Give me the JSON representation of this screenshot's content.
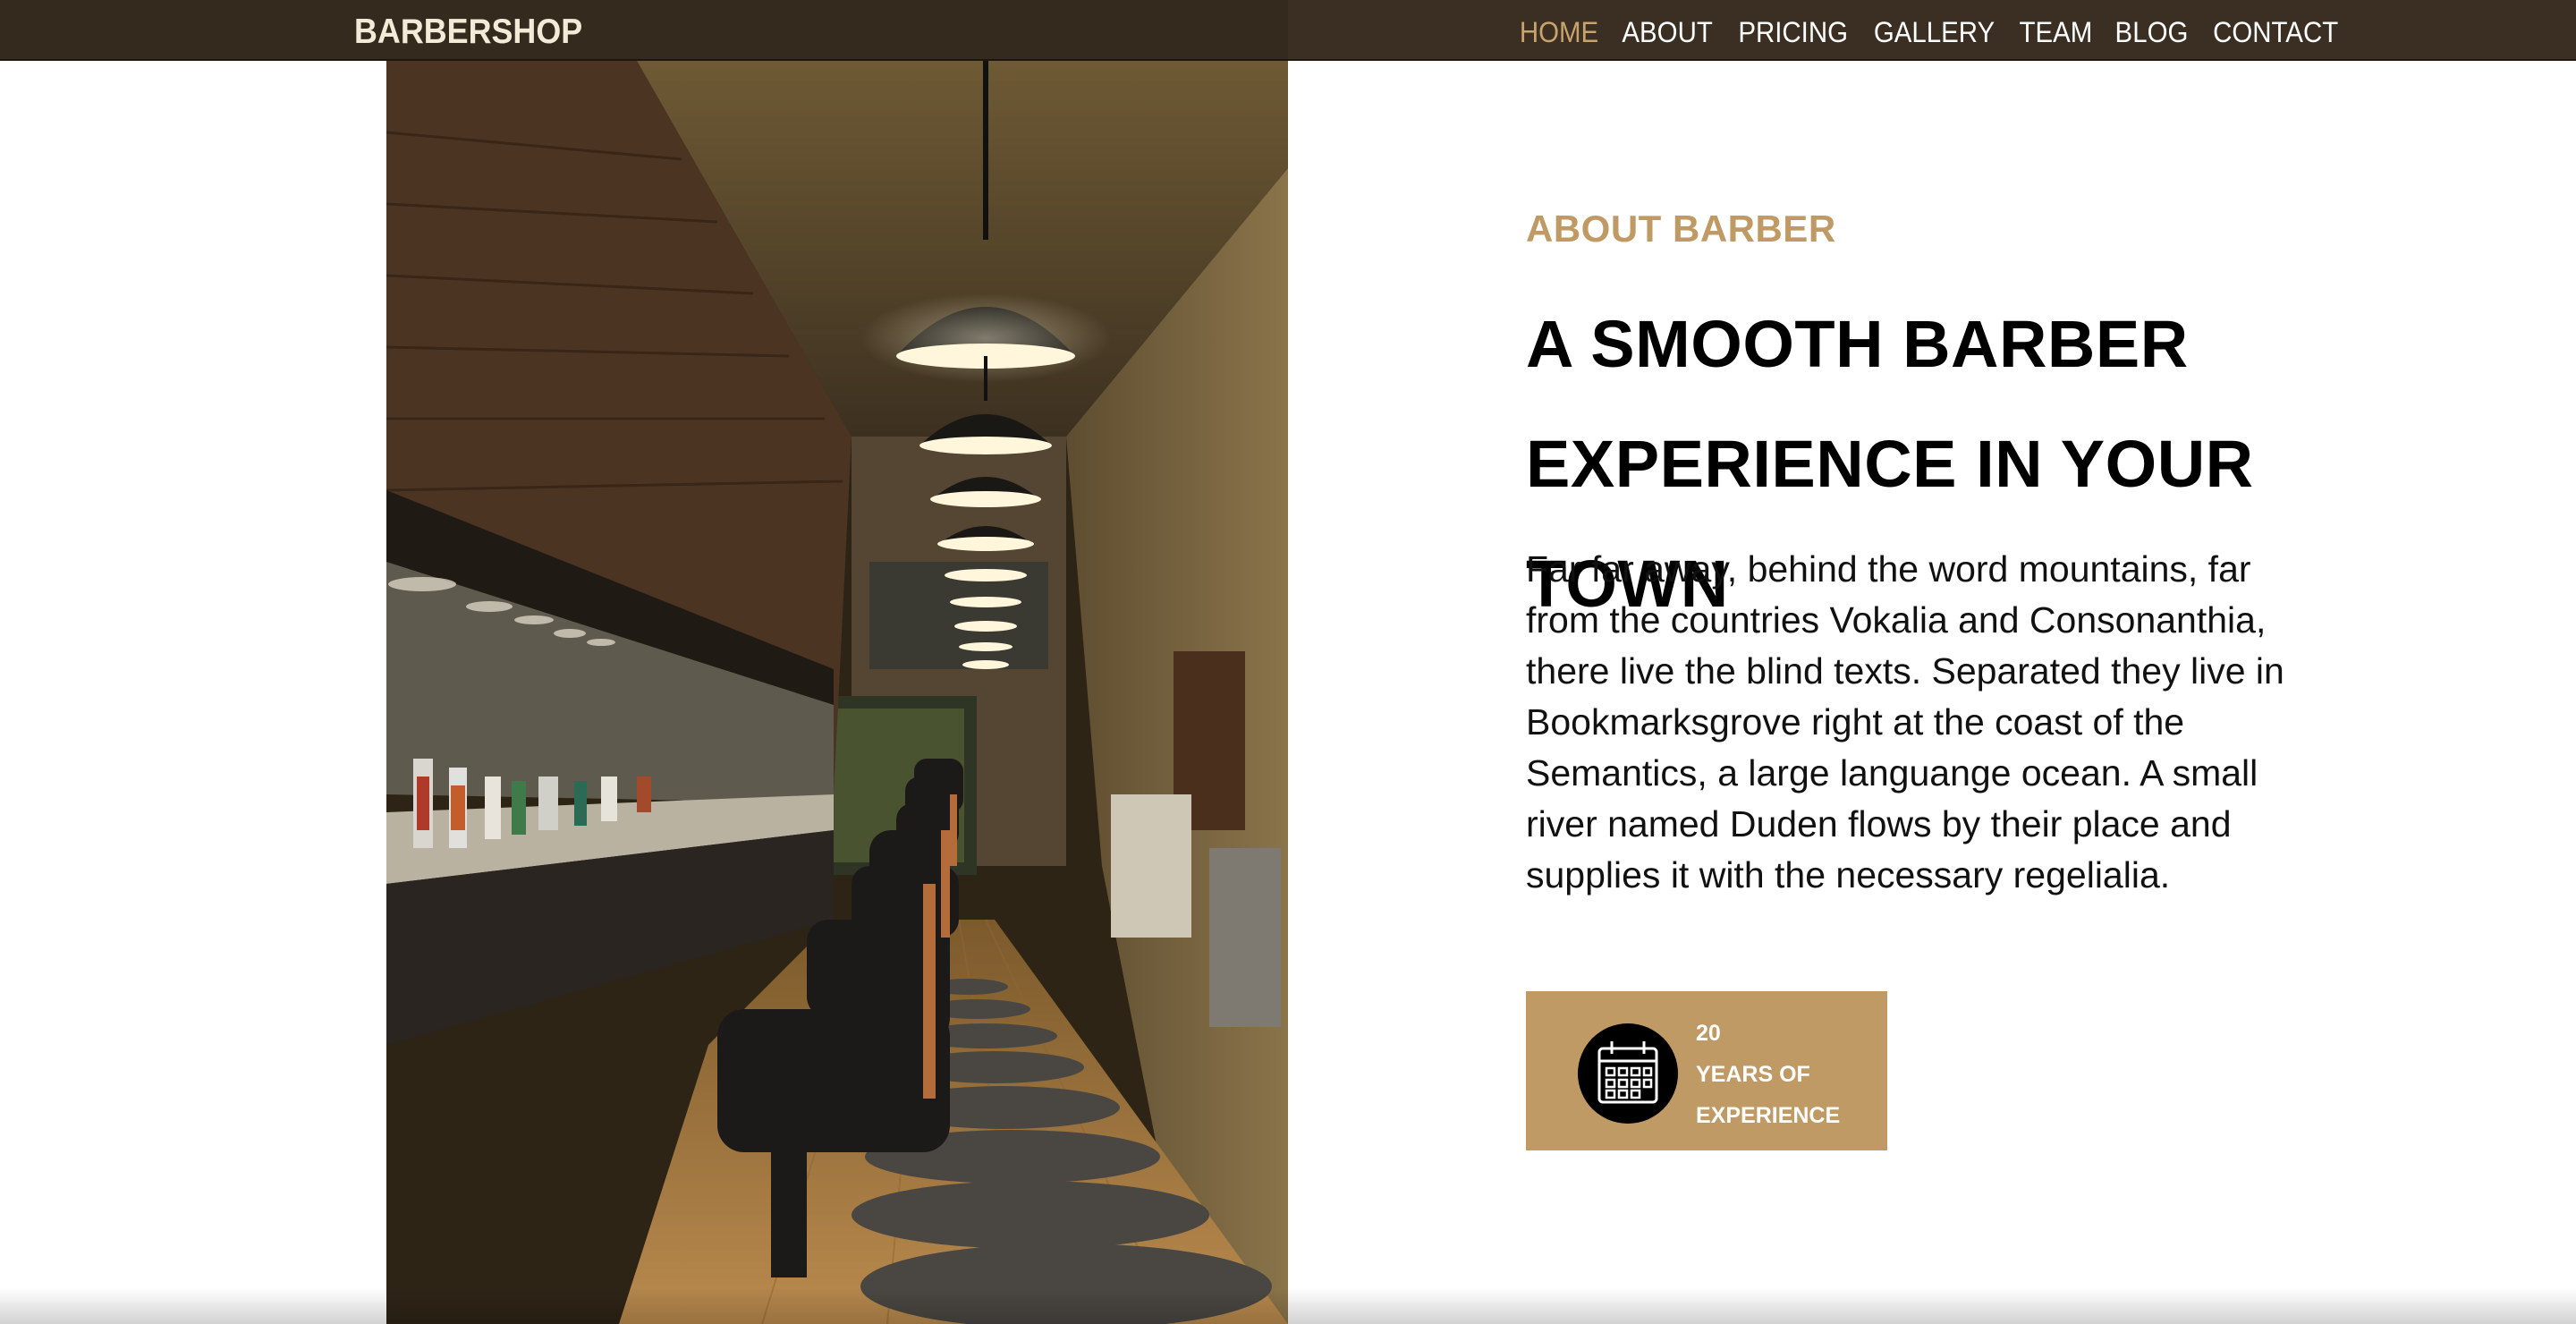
{
  "navbar": {
    "brand": "BARBERSHOP",
    "items": [
      {
        "label": "HOME",
        "active": true
      },
      {
        "label": "ABOUT"
      },
      {
        "label": "PRICING"
      },
      {
        "label": "GALLERY"
      },
      {
        "label": "TEAM"
      },
      {
        "label": "BLOG"
      },
      {
        "label": "CONTACT"
      }
    ]
  },
  "about": {
    "subtitle": "ABOUT BARBER",
    "heading_line1": "A SMOOTH BARBER",
    "heading_line2": "EXPERIENCE IN YOUR TOWN",
    "body": "Far far away, behind the word mountains, far from the countries Vokalia and Consonanthia, there live the blind texts. Separated they live in Bookmarksgrove right at the coast of the Semantics, a large languange ocean. A small river named Duden flows by their place and supplies it with the necessary regelialia.",
    "experience": {
      "number": "20",
      "line1": "YEARS OF",
      "line2": "EXPERIENCE",
      "icon": "calendar-icon"
    }
  },
  "colors": {
    "nav_bg": "#3a2f22",
    "accent": "#c09a64",
    "nav_active": "#c9a36e"
  }
}
